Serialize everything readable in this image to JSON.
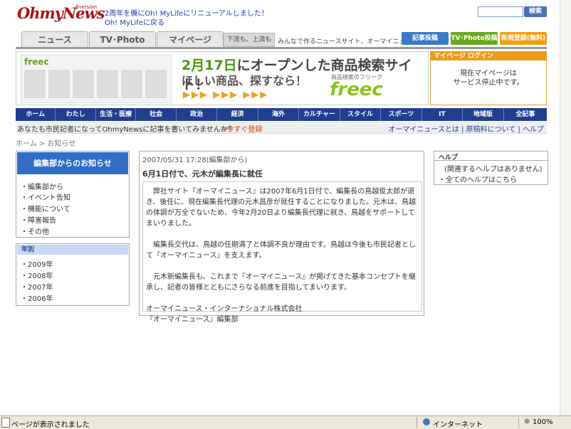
{
  "header": {
    "logo": "OhmyNews",
    "logo_badge": "βversion",
    "notice_line1": "2周年を機にOh! MyLifeにリニューアルしました！",
    "notice_line2": "Oh! MyLifeに戻る",
    "search_button": "検索"
  },
  "tabs": [
    "ニュース",
    "TV･Photo",
    "マイページ"
  ],
  "tagline_tab": "下流も、上流も",
  "tagline": "みんなで作るニュースサイト、オーマイニュース",
  "top_buttons": [
    "記事投稿",
    "TV･Photo投稿",
    "新規登録(無料)"
  ],
  "banner": {
    "shot_logo": "freec",
    "headline_date": "2月17日",
    "headline_rest": "にオープンした商品検索サイト！",
    "subline": "ほしい商品、探すなら！",
    "arrows": "▶▶▶ ▶▶▶ ▶▶▶",
    "brand_sub": "商品検索のフリーク",
    "brand": "freec"
  },
  "mypage": {
    "head": "マイページ ログイン",
    "line1": "現在マイページは",
    "line2": "サービス停止中です。"
  },
  "nav": [
    "ホーム",
    "わたし",
    "生活・医療",
    "社会",
    "政治",
    "経済",
    "海外",
    "カルチャー",
    "スタイル",
    "スポーツ",
    "IT",
    "地域版",
    "全記事"
  ],
  "subbar": {
    "left": "あなたも市民記者になってOhmyNewsに記事を書いてみませんか？",
    "cta": "⇒今すぐ登録",
    "right": "オーマイニュースとは | 原稿料について | ヘルプ"
  },
  "breadcrumb": "ホーム > お知らせ",
  "news_box": {
    "head": "編集部からのお知らせ",
    "links": [
      "・編集部から",
      "・イベント告知",
      "・機能について",
      "・障害報告",
      "・その他"
    ]
  },
  "year_box": {
    "head": "年別",
    "links": [
      "・2009年",
      "・2008年",
      "・2007年",
      "・2006年"
    ]
  },
  "article": {
    "date": "2007/05/31 17:28(編集部から)",
    "title": "6月1日付で、元木が編集長に就任",
    "body": "　弊社サイト『オーマイニュース』は2007年6月1日付で、編集長の鳥越俊太郎が退き、後任に、現在編集長代理の元木昌彦が就任することになりました。元木は、鳥越の体調が万全でないため、今年2月20日より編集長代理に就き、鳥越をサポートしてまいりました。\n\n　編集長交代は、鳥越の任期満了と体調不良が理由です。鳥越は今後も市民記者として『オーマイニュース』を支えます。\n\n　元木新編集長も、これまで『オーマイニュース』が掲げてきた基本コンセプトを継承し、記者の皆様とともにさらなる前進を目指してまいります。\n\nオーマイニュース・インターナショナル株式会社\n『オーマイニュース』編集部"
  },
  "help": {
    "head": "ヘルプ",
    "line1": "(関連するヘルプはありません)",
    "line2": "・全てのヘルプはこちら"
  },
  "status": {
    "text": "ページが表示されました",
    "zone": "インターネット",
    "zoom": "100%"
  }
}
